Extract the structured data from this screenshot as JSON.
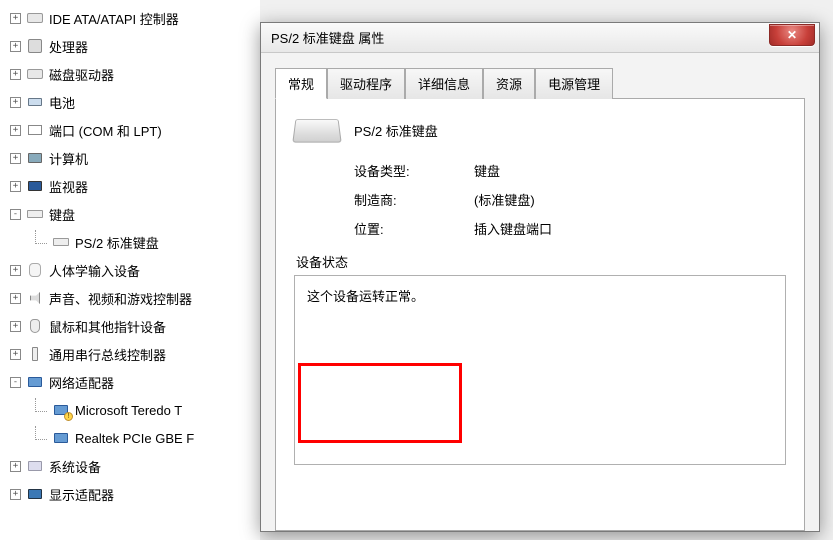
{
  "tree": {
    "items": [
      {
        "label": "IDE ATA/ATAPI 控制器",
        "icon": "ic-drive",
        "toggle": "+"
      },
      {
        "label": "处理器",
        "icon": "ic-cpu",
        "toggle": "+"
      },
      {
        "label": "磁盘驱动器",
        "icon": "ic-drive",
        "toggle": "+"
      },
      {
        "label": "电池",
        "icon": "ic-battery",
        "toggle": "+"
      },
      {
        "label": "端口 (COM 和 LPT)",
        "icon": "ic-port",
        "toggle": "+"
      },
      {
        "label": "计算机",
        "icon": "ic-computer",
        "toggle": "+"
      },
      {
        "label": "监视器",
        "icon": "ic-monitor",
        "toggle": "+"
      },
      {
        "label": "键盘",
        "icon": "ic-keyboard",
        "toggle": "-",
        "children": [
          {
            "label": "PS/2 标准键盘",
            "icon": "ic-keyboard"
          }
        ]
      },
      {
        "label": "人体学输入设备",
        "icon": "ic-hid",
        "toggle": "+"
      },
      {
        "label": "声音、视频和游戏控制器",
        "icon": "ic-sound",
        "toggle": "+"
      },
      {
        "label": "鼠标和其他指针设备",
        "icon": "ic-mouse",
        "toggle": "+"
      },
      {
        "label": "通用串行总线控制器",
        "icon": "ic-usb",
        "toggle": "+"
      },
      {
        "label": "网络适配器",
        "icon": "ic-net",
        "toggle": "-",
        "children": [
          {
            "label": "Microsoft Teredo T",
            "icon": "ic-net",
            "warn": true
          },
          {
            "label": "Realtek PCIe GBE F",
            "icon": "ic-net"
          }
        ]
      },
      {
        "label": "系统设备",
        "icon": "ic-sys",
        "toggle": "+"
      },
      {
        "label": "显示适配器",
        "icon": "ic-display",
        "toggle": "+"
      }
    ]
  },
  "dialog": {
    "title": "PS/2 标准键盘 属性",
    "close_label": "✕",
    "tabs": [
      {
        "label": "常规"
      },
      {
        "label": "驱动程序"
      },
      {
        "label": "详细信息"
      },
      {
        "label": "资源"
      },
      {
        "label": "电源管理"
      }
    ],
    "device_name": "PS/2 标准键盘",
    "props": {
      "type_k": "设备类型:",
      "type_v": "键盘",
      "mfr_k": "制造商:",
      "mfr_v": "(标准键盘)",
      "loc_k": "位置:",
      "loc_v": "插入键盘端口"
    },
    "status_label": "设备状态",
    "status_text": "这个设备运转正常。"
  }
}
